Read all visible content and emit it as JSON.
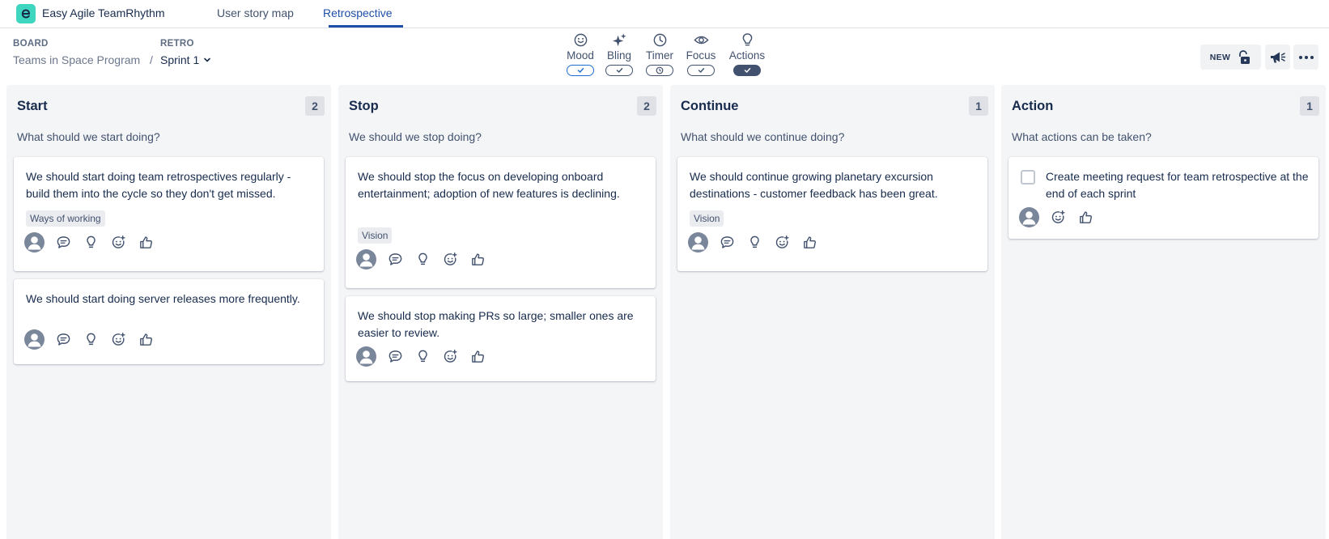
{
  "app": {
    "name": "Easy Agile TeamRhythm"
  },
  "tabs": [
    {
      "label": "User story map",
      "active": false
    },
    {
      "label": "Retrospective",
      "active": true
    }
  ],
  "header": {
    "board_label": "BOARD",
    "board_value": "Teams in Space Program",
    "separator": "/",
    "retro_label": "RETRO",
    "retro_value": "Sprint 1"
  },
  "tools": [
    {
      "label": "Mood",
      "icon": "smiley-icon",
      "toggle": "on-outline-blue"
    },
    {
      "label": "Bling",
      "icon": "sparkle-icon",
      "toggle": "on-outline"
    },
    {
      "label": "Timer",
      "icon": "clock-icon",
      "toggle": "clock"
    },
    {
      "label": "Focus",
      "icon": "eye-icon",
      "toggle": "on-outline"
    },
    {
      "label": "Actions",
      "icon": "lightbulb-icon",
      "toggle": "on-filled"
    }
  ],
  "right_actions": {
    "new_badge": "NEW",
    "lock_icon": "unlock-icon",
    "announce_icon": "megaphone-icon",
    "more_icon": "more-icon"
  },
  "columns": [
    {
      "title": "Start",
      "count": "2",
      "subtitle": "What should we start doing?",
      "cards": [
        {
          "text": "We should start doing team retrospectives regularly - build them into the cycle so they don't get missed.",
          "tag": "Ways of working"
        },
        {
          "text": "We should start doing server releases more frequently.",
          "tag": ""
        }
      ]
    },
    {
      "title": "Stop",
      "count": "2",
      "subtitle": "We should we stop doing?",
      "cards": [
        {
          "text": "We should stop the focus on developing onboard entertainment; adoption of new features is declining.",
          "tag": "Vision"
        },
        {
          "text": "We should stop making PRs so large; smaller ones are easier to review.",
          "tag": ""
        }
      ]
    },
    {
      "title": "Continue",
      "count": "1",
      "subtitle": "What should we continue doing?",
      "cards": [
        {
          "text": "We should continue growing planetary excursion destinations - customer feedback has been great.",
          "tag": "Vision"
        }
      ]
    },
    {
      "title": "Action",
      "count": "1",
      "subtitle": "What actions can be taken?",
      "cards": [
        {
          "text": "Create meeting request for team retrospective at the end of each sprint",
          "tag": ""
        }
      ]
    }
  ],
  "colors": {
    "accent": "#1f4fa8",
    "logo": "#3fd6c0",
    "column_bg": "#f4f5f7",
    "text": "#172b4d",
    "muted": "#42526e"
  }
}
